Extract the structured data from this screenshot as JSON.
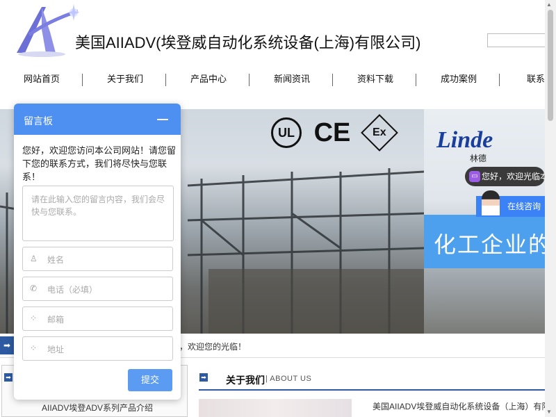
{
  "header": {
    "company_title": "美国AIIADV(埃登威自动化系统设备(上海)有限公司)",
    "search_placeholder": ""
  },
  "nav": {
    "items": [
      {
        "label": "网站首页"
      },
      {
        "label": "关于我们"
      },
      {
        "label": "产品中心"
      },
      {
        "label": "新闻资讯"
      },
      {
        "label": "资料下载"
      },
      {
        "label": "成功案例"
      },
      {
        "label": "联系"
      }
    ]
  },
  "banner": {
    "cert_ul": "UL",
    "cert_ce": "CE",
    "cert_ex": "Ex",
    "linde_logo": "Linde",
    "linde_cn": "林德",
    "band_text": "化工企业的"
  },
  "chat_widget": {
    "bubble_text": "您好，欢迎光临本公司网站！",
    "consult_label": "在线咨询"
  },
  "ticker": {
    "arrow": "➡",
    "text": "，欢迎您的光临！"
  },
  "lower": {
    "left_item": "AIIADV埃登ADV系列产品介绍",
    "about_title": "关于我们",
    "about_sub": "| ABOUT US",
    "about_text": "美国AIIADV埃登威自动化系统设备（上海）有限公司，是一家集研发、生产"
  },
  "message_panel": {
    "title": "留言板",
    "intro": "您好，欢迎您访问本公司网站！请您留下您的联系方式，我们将尽快与您联系！",
    "content_placeholder": "请在此输入您的留言内容，我们会尽快与您联系。",
    "fields": [
      {
        "icon": "user-icon",
        "glyph": "♙",
        "label": "姓名"
      },
      {
        "icon": "phone-icon",
        "glyph": "✆",
        "label": "电话（必填）"
      },
      {
        "icon": "grid-icon",
        "glyph": "⁘",
        "label": "邮箱"
      },
      {
        "icon": "grid-icon",
        "glyph": "⁘",
        "label": "地址"
      }
    ],
    "submit_label": "提交"
  },
  "colors": {
    "accent": "#4e8ff2",
    "nav_accent": "#2d5aa0",
    "band": "#4da0ee"
  }
}
